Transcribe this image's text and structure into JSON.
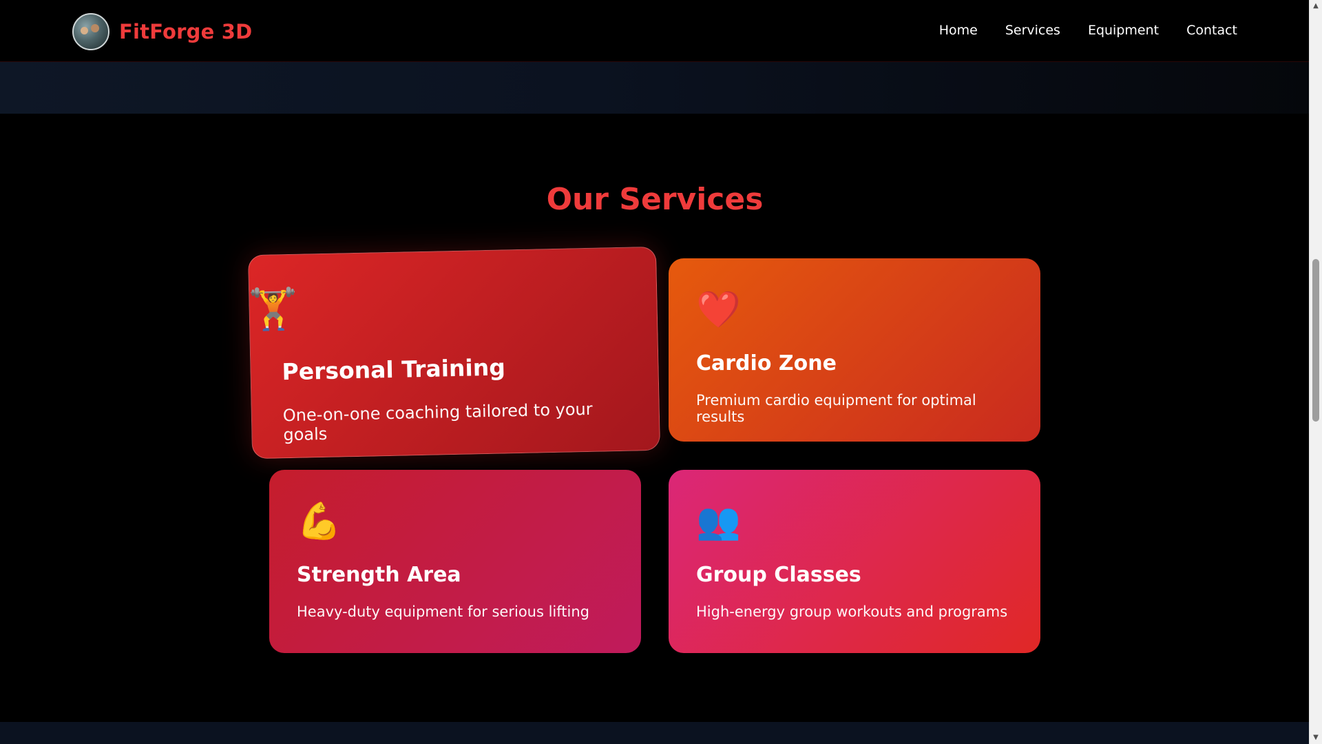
{
  "navbar": {
    "brand_name": "FitForge 3D",
    "links": [
      {
        "label": "Home"
      },
      {
        "label": "Services"
      },
      {
        "label": "Equipment"
      },
      {
        "label": "Contact"
      }
    ]
  },
  "services": {
    "title": "Our Services",
    "cards": [
      {
        "icon": "🏋️",
        "icon_name": "weightlifter-icon",
        "title": "Personal Training",
        "description": "One-on-one coaching tailored to your goals"
      },
      {
        "icon": "❤️",
        "icon_name": "heart-icon",
        "title": "Cardio Zone",
        "description": "Premium cardio equipment for optimal results"
      },
      {
        "icon": "💪",
        "icon_name": "flexed-biceps-icon",
        "title": "Strength Area",
        "description": "Heavy-duty equipment for serious lifting"
      },
      {
        "icon": "👥",
        "icon_name": "group-people-icon",
        "title": "Group Classes",
        "description": "High-energy group workouts and programs"
      }
    ]
  },
  "colors": {
    "brand_red": "#ef3b3b",
    "background": "#000000",
    "card_red": "#dc2626",
    "card_orange": "#e65a0d",
    "card_crimson": "#c51d2c",
    "card_pink": "#db2777"
  },
  "scrollbar": {
    "up_arrow": "▲",
    "down_arrow": "▼"
  }
}
